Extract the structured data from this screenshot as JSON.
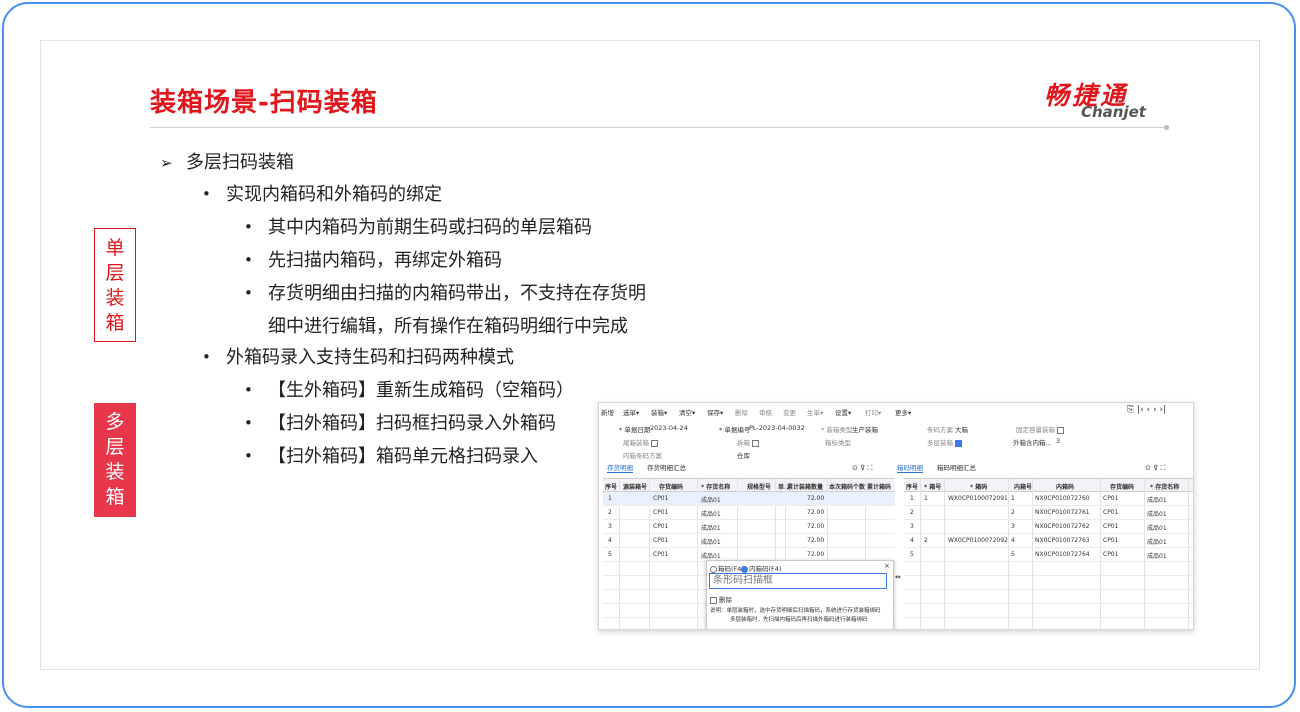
{
  "slide": {
    "title": "装箱场景-扫码装箱",
    "logo_cn": "畅捷通",
    "logo_en": "Chanjet",
    "arrow": "➢",
    "bullet": "•",
    "items": {
      "l1": "多层扫码装箱",
      "l2a": "实现内箱码和外箱码的绑定",
      "l3a": "其中内箱码为前期生码或扫码的单层箱码",
      "l3b": "先扫描内箱码，再绑定外箱码",
      "l3c1": "存货明细由扫描的内箱码带出，不支持在存货明",
      "l3c2": "细中进行编辑，所有操作在箱码明细行中完成",
      "l2b": "外箱码录入支持生码和扫码两种模式",
      "l3d": "【生外箱码】重新生成箱码（空箱码）",
      "l3e": "【扫外箱码】扫码框扫码录入外箱码",
      "l3f": "【扫外箱码】箱码单元格扫码录入"
    },
    "side_single": [
      "单",
      "层",
      "装",
      "箱"
    ],
    "side_multi": [
      "多",
      "层",
      "装",
      "箱"
    ]
  },
  "app": {
    "toolbar": [
      "新增",
      "选单▾",
      "装箱▾",
      "清空▾",
      "保存▾",
      "删除",
      "审核",
      "变更",
      "生单▾",
      "设置▾",
      "打印▾",
      "更多▾"
    ],
    "toolbar_right": "⎘ |‹ ‹ › ›|",
    "form": {
      "date_label": "* 单据日期",
      "date": "2023-04-24",
      "code_label": "* 单据编号",
      "code": "PL-2023-04-0032",
      "type_label": "* 装箱类型",
      "type": "生产装箱",
      "scheme_label": "条码方案",
      "scheme": "大箱",
      "fixed_label": "固定容量装箱",
      "tail_label": "尾箱装箱",
      "removed_label": "拆箱",
      "box_type_label": "箱标类型",
      "multi_label": "多层装箱",
      "outer_label": "外箱含内箱...",
      "outer_value": "3",
      "inner_scheme_label": "内箱条码方案",
      "warehouse_label": "仓库"
    },
    "left_tabs": [
      "存货明细",
      "存货明细汇总"
    ],
    "right_tabs": [
      "箱码明细",
      "箱码明细汇总"
    ],
    "left_headers": [
      "序号",
      "源装箱号",
      "存货编码",
      "* 存货名称",
      "规格型号",
      "单..",
      "累计装箱数量",
      "本次箱码个数",
      "累计箱码"
    ],
    "left_rows": [
      [
        "1",
        "",
        "CP01",
        "成品01",
        "",
        "",
        "72.00",
        "",
        ""
      ],
      [
        "2",
        "",
        "CP01",
        "成品01",
        "",
        "",
        "72.00",
        "",
        ""
      ],
      [
        "3",
        "",
        "CP01",
        "成品01",
        "",
        "",
        "72.00",
        "",
        ""
      ],
      [
        "4",
        "",
        "CP01",
        "成品01",
        "",
        "",
        "72.00",
        "",
        ""
      ],
      [
        "5",
        "",
        "CP01",
        "成品01",
        "",
        "",
        "72.00",
        "",
        ""
      ]
    ],
    "right_headers": [
      "序号",
      "* 箱号",
      "* 箱码",
      "内箱号",
      "内箱码",
      "存货编码",
      "* 存货名称"
    ],
    "right_rows": [
      [
        "1",
        "1",
        "WX0CP0100072091",
        "1",
        "NX0CP010072760",
        "CP01",
        "成品01"
      ],
      [
        "2",
        "",
        "",
        "2",
        "NX0CP010072761",
        "CP01",
        "成品01"
      ],
      [
        "3",
        "",
        "",
        "3",
        "NX0CP010072762",
        "CP01",
        "成品01"
      ],
      [
        "4",
        "2",
        "WX0CP0100072092",
        "4",
        "NX0CP010072763",
        "CP01",
        "成品01"
      ],
      [
        "5",
        "",
        "",
        "5",
        "NX0CP010072764",
        "CP01",
        "成品01"
      ]
    ],
    "popup": {
      "radio1": "箱码(F4)",
      "radio2": "内箱码(F4)",
      "placeholder": "条形码扫描框",
      "delete_label": "删除",
      "note1": "说明：单层装箱时，选中存货明细后扫描箱码，系统进行存货装箱绑码",
      "note2": "多层装箱时，先扫描内箱码后再扫描外箱码进行装箱绑码"
    }
  }
}
